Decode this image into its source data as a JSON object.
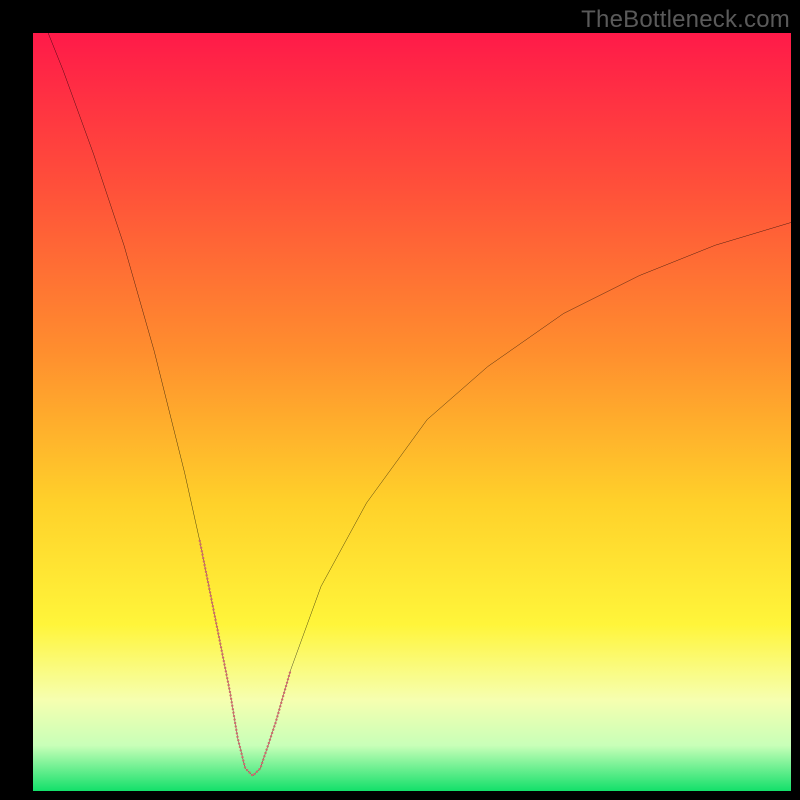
{
  "watermark": {
    "text": "TheBottleneck.com"
  },
  "colors": {
    "background": "#000000",
    "watermark": "#5a5a5a",
    "curve": "#000000",
    "dotted_segment": "#cf6a6d",
    "gradient_stops": [
      {
        "offset": 0.0,
        "color": "#ff1a49"
      },
      {
        "offset": 0.2,
        "color": "#ff4f3a"
      },
      {
        "offset": 0.42,
        "color": "#ff8e2e"
      },
      {
        "offset": 0.62,
        "color": "#ffd12a"
      },
      {
        "offset": 0.78,
        "color": "#fff53a"
      },
      {
        "offset": 0.88,
        "color": "#f6ffb0"
      },
      {
        "offset": 0.94,
        "color": "#c8ffb8"
      },
      {
        "offset": 1.0,
        "color": "#13e06a"
      }
    ]
  },
  "chart_data": {
    "type": "line",
    "title": "",
    "xlabel": "",
    "ylabel": "",
    "xlim": [
      0,
      100
    ],
    "ylim": [
      0,
      100
    ],
    "grid": false,
    "legend": false,
    "series": [
      {
        "name": "bottleneck-curve",
        "x": [
          0,
          4,
          8,
          12,
          16,
          20,
          22,
          24,
          26,
          27,
          28,
          29,
          30,
          32,
          34,
          38,
          44,
          52,
          60,
          70,
          80,
          90,
          100
        ],
        "values": [
          105,
          95,
          84,
          72,
          58,
          42,
          33,
          23,
          13,
          7,
          3,
          2,
          3,
          9,
          16,
          27,
          38,
          49,
          56,
          63,
          68,
          72,
          75
        ]
      }
    ],
    "dotted_segment": {
      "x": [
        22,
        24,
        26,
        27,
        28,
        29,
        30,
        32,
        34
      ],
      "values": [
        33,
        23,
        13,
        7,
        3,
        2,
        3,
        9,
        16
      ],
      "note": "bottom of curve rendered as thick salmon dotted segment"
    },
    "annotations": [
      {
        "text": "TheBottleneck.com",
        "position": "top-right",
        "role": "watermark"
      }
    ]
  }
}
